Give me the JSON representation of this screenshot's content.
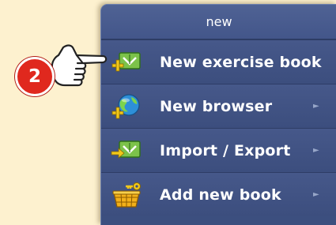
{
  "menu": {
    "header": "new",
    "items": [
      {
        "label": "New exercise book",
        "icon": "exercise-book-add-icon",
        "has_submenu": false
      },
      {
        "label": "New browser",
        "icon": "globe-add-icon",
        "has_submenu": true
      },
      {
        "label": "Import / Export",
        "icon": "import-export-icon",
        "has_submenu": true
      },
      {
        "label": "Add new book",
        "icon": "basket-key-icon",
        "has_submenu": true
      }
    ],
    "submenu_arrow": "►"
  },
  "callout": {
    "step_number": "2",
    "pointer_icon": "pointing-hand-icon"
  },
  "colors": {
    "background": "#fdf1cf",
    "menu": "#3c4f7f",
    "badge": "#e0281e"
  }
}
